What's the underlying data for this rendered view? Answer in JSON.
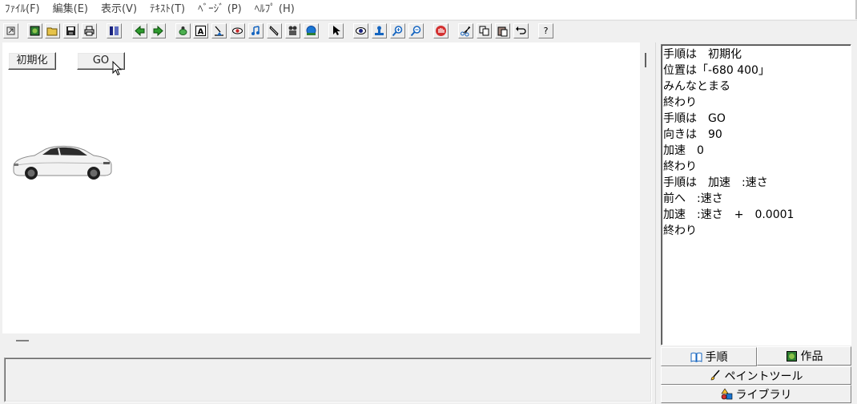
{
  "menubar": {
    "items": [
      "ﾌｧｲﾙ(F)",
      "編集(E)",
      "表示(V)",
      "ﾃｷｽﾄ(T)",
      "ﾍﾞｰｼﾞ (P)",
      "ﾍﾙﾌﾟ (H)"
    ]
  },
  "toolbar": {
    "help_label": "?"
  },
  "canvas": {
    "init_button": "初期化",
    "go_button": "GO"
  },
  "script": {
    "lines": [
      "手順は　初期化",
      "位置は「-680 400」",
      "みんなとまる",
      "終わり",
      "手順は　GO",
      "向きは　90",
      "加速　0",
      "終わり",
      "手順は　加速　:速さ",
      "前へ　:速さ",
      "加速　:速さ　+　0.0001",
      "終わり"
    ]
  },
  "tabs": {
    "procedure": "手順",
    "works": "作品",
    "paint_tool": "ペイントツール",
    "library": "ライブラリ"
  }
}
